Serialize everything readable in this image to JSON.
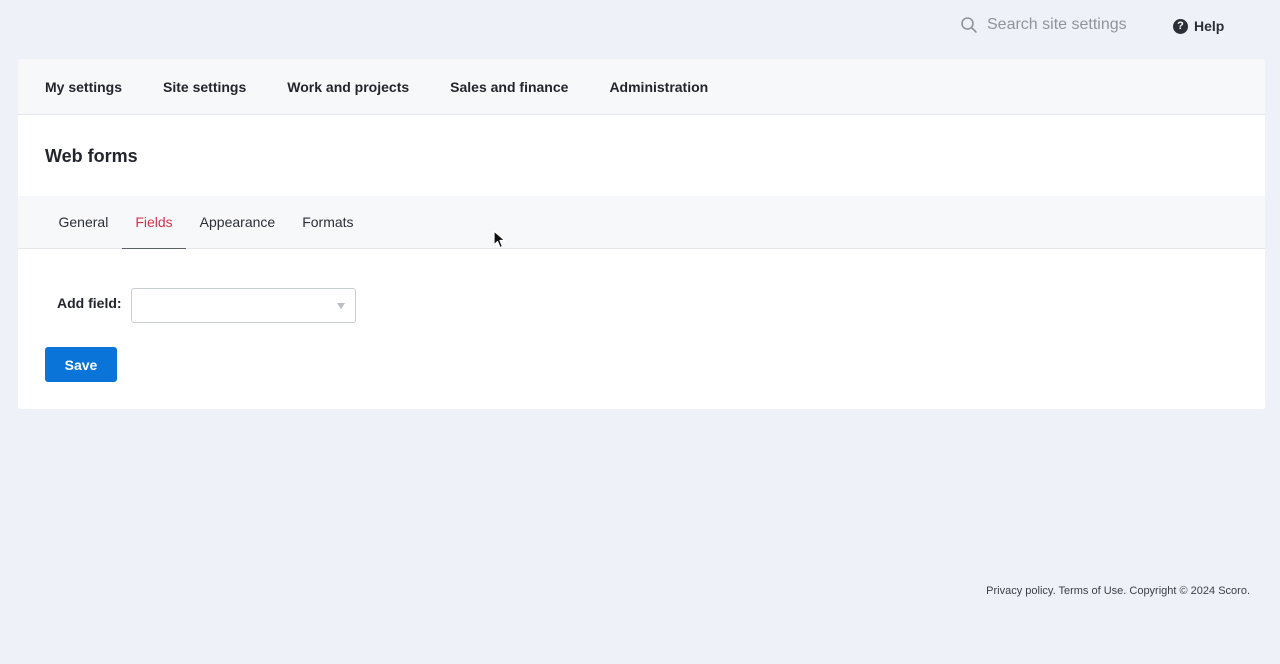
{
  "topbar": {
    "search_placeholder": "Search site settings",
    "help_label": "Help",
    "search_icon": "search-icon",
    "help_icon": "question-circle-icon"
  },
  "main_nav": {
    "items": [
      "My settings",
      "Site settings",
      "Work and projects",
      "Sales and finance",
      "Administration"
    ]
  },
  "page": {
    "title": "Web forms"
  },
  "tabs": {
    "items": [
      "General",
      "Fields",
      "Appearance",
      "Formats"
    ],
    "active": "Fields"
  },
  "form": {
    "add_field_label": "Add field:",
    "add_field_value": "",
    "save_label": "Save"
  },
  "footer": {
    "text": "Privacy policy. Terms of Use. Copyright © 2024 Scoro."
  },
  "colors": {
    "accent": "#0a74d8",
    "active_tab": "#d1334a",
    "background": "#eef2f8"
  }
}
